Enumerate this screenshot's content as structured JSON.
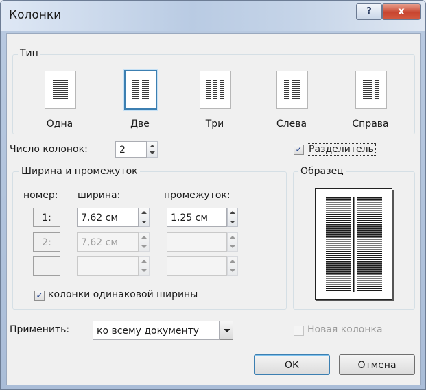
{
  "window": {
    "title": "Колонки",
    "help_label": "?",
    "close_label": "x"
  },
  "type_group": {
    "label": "Тип",
    "presets": [
      {
        "label": "Одна",
        "selected": false
      },
      {
        "label": "Две",
        "selected": true
      },
      {
        "label": "Три",
        "selected": false
      },
      {
        "label": "Слева",
        "selected": false
      },
      {
        "label": "Справа",
        "selected": false
      }
    ]
  },
  "columns": {
    "label": "Число колонок:",
    "value": "2"
  },
  "separator": {
    "label": "Разделитель",
    "checked": true
  },
  "width_group": {
    "label": "Ширина и промежуток",
    "headers": {
      "number": "номер:",
      "width": "ширина:",
      "spacing": "промежуток:"
    },
    "rows": [
      {
        "number": "1:",
        "width": "7,62 см",
        "spacing": "1,25 см",
        "enabled": true
      },
      {
        "number": "2:",
        "width": "7,62 см",
        "spacing": "",
        "enabled": false
      },
      {
        "number": "",
        "width": "",
        "spacing": "",
        "enabled": false
      }
    ],
    "equal_width_label": "колонки одинаковой ширины"
  },
  "preview_group": {
    "label": "Образец"
  },
  "apply": {
    "label": "Применить:",
    "value": "ко всему документу"
  },
  "new_column": {
    "label": "Новая колонка",
    "checked": false,
    "enabled": false
  },
  "buttons": {
    "ok": "ОК",
    "cancel": "Отмена"
  }
}
